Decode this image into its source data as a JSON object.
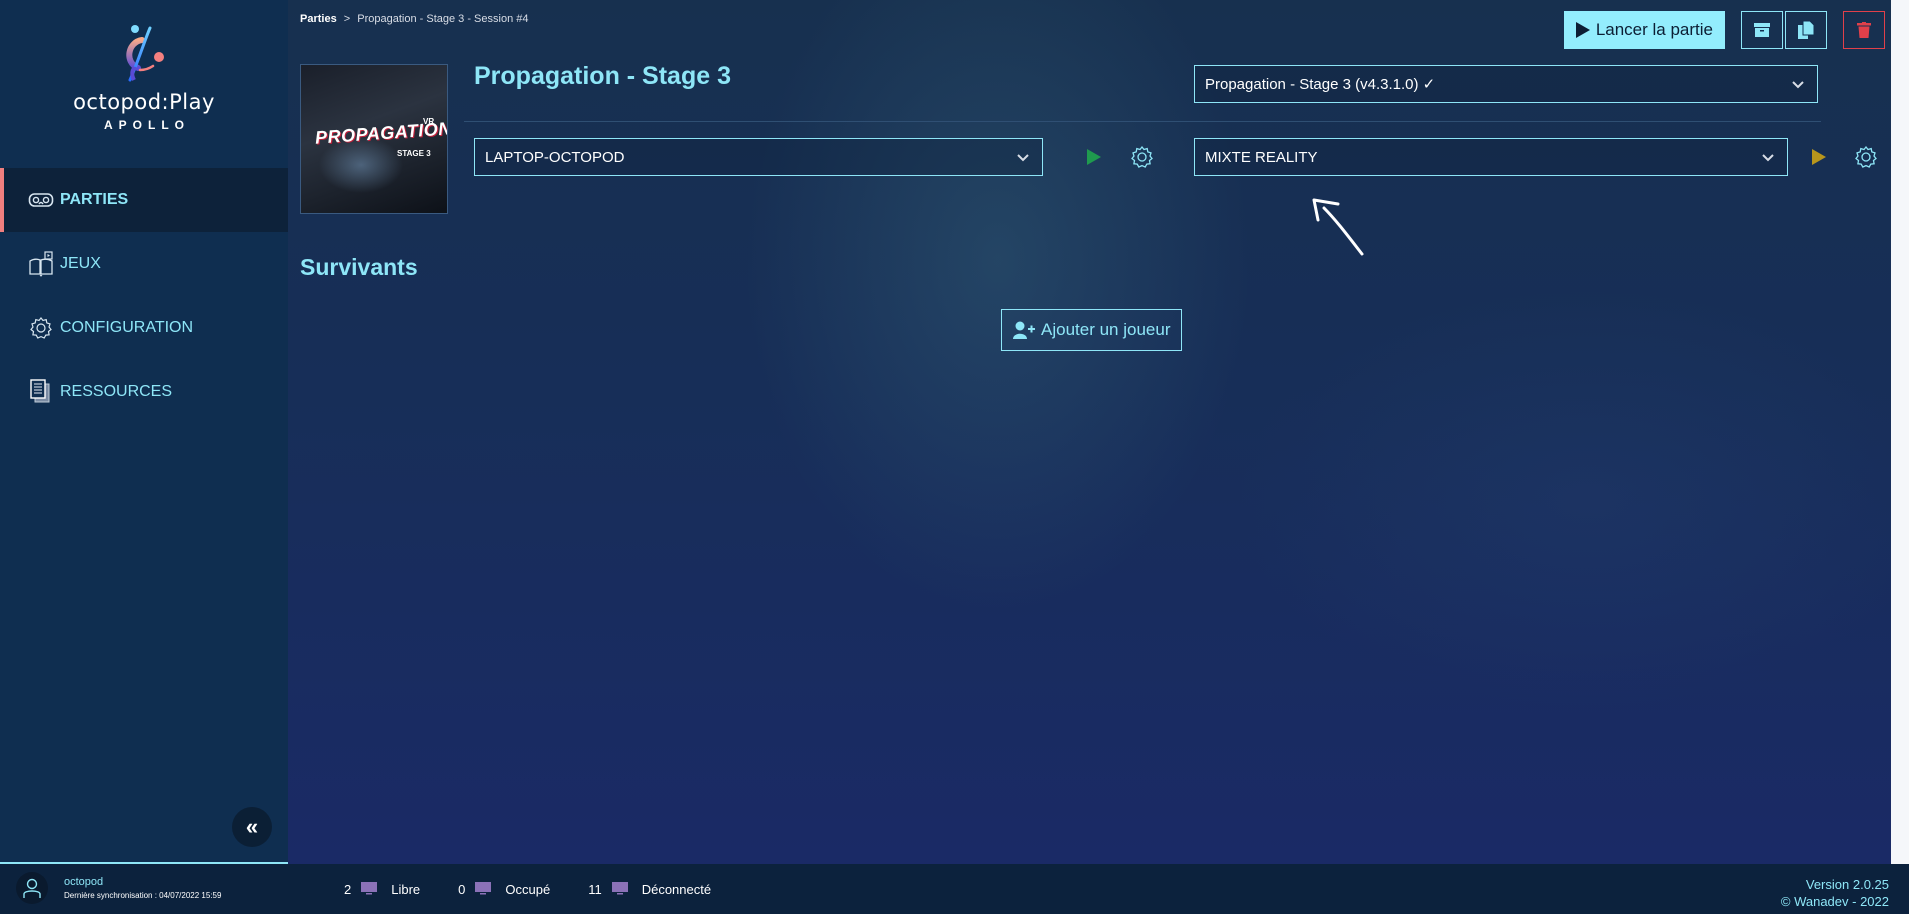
{
  "brand": {
    "name": "octopod:Play",
    "edition": "APOLLO"
  },
  "sidebar": {
    "items": [
      {
        "label": "PARTIES",
        "icon": "vr-headset-icon",
        "active": true
      },
      {
        "label": "JEUX",
        "icon": "book-play-icon",
        "active": false
      },
      {
        "label": "CONFIGURATION",
        "icon": "gear-icon",
        "active": false
      },
      {
        "label": "RESSOURCES",
        "icon": "documents-icon",
        "active": false
      }
    ],
    "collapse_glyph": "«"
  },
  "breadcrumb": {
    "root": "Parties",
    "separator": ">",
    "current": "Propagation - Stage 3 - Session #4"
  },
  "toolbar": {
    "launch_label": "Lancer la partie",
    "archive_icon": "archive-icon",
    "copy_icon": "copy-icon",
    "delete_icon": "trash-icon"
  },
  "game": {
    "title": "Propagation - Stage 3",
    "cover": {
      "title": "PROPAGATION",
      "vr": "VR",
      "stage": "STAGE 3"
    },
    "version_select": "Propagation - Stage 3 (v4.3.1.0) ✓",
    "host_select": "LAPTOP-OCTOPOD",
    "mode_select": "MIXTE REALITY"
  },
  "colors": {
    "accent": "#8ee6f7",
    "launch_bg": "#93edfd",
    "active_marker": "#f07f7f",
    "play_green": "#1f9a4e",
    "play_gold": "#b8961c",
    "danger": "#e0404a",
    "monitor": "#8b72b8"
  },
  "survivors": {
    "title": "Survivants",
    "add_label": "Ajouter un joueur"
  },
  "footer": {
    "user": {
      "name": "octopod",
      "sync": "Dernière synchronisation : 04/07/2022 15:59"
    },
    "stats": [
      {
        "count": "2",
        "label": "Libre"
      },
      {
        "count": "0",
        "label": "Occupé"
      },
      {
        "count": "11",
        "label": "Déconnecté"
      }
    ],
    "version": "Version 2.0.25",
    "copyright": "© Wanadev - 2022"
  }
}
